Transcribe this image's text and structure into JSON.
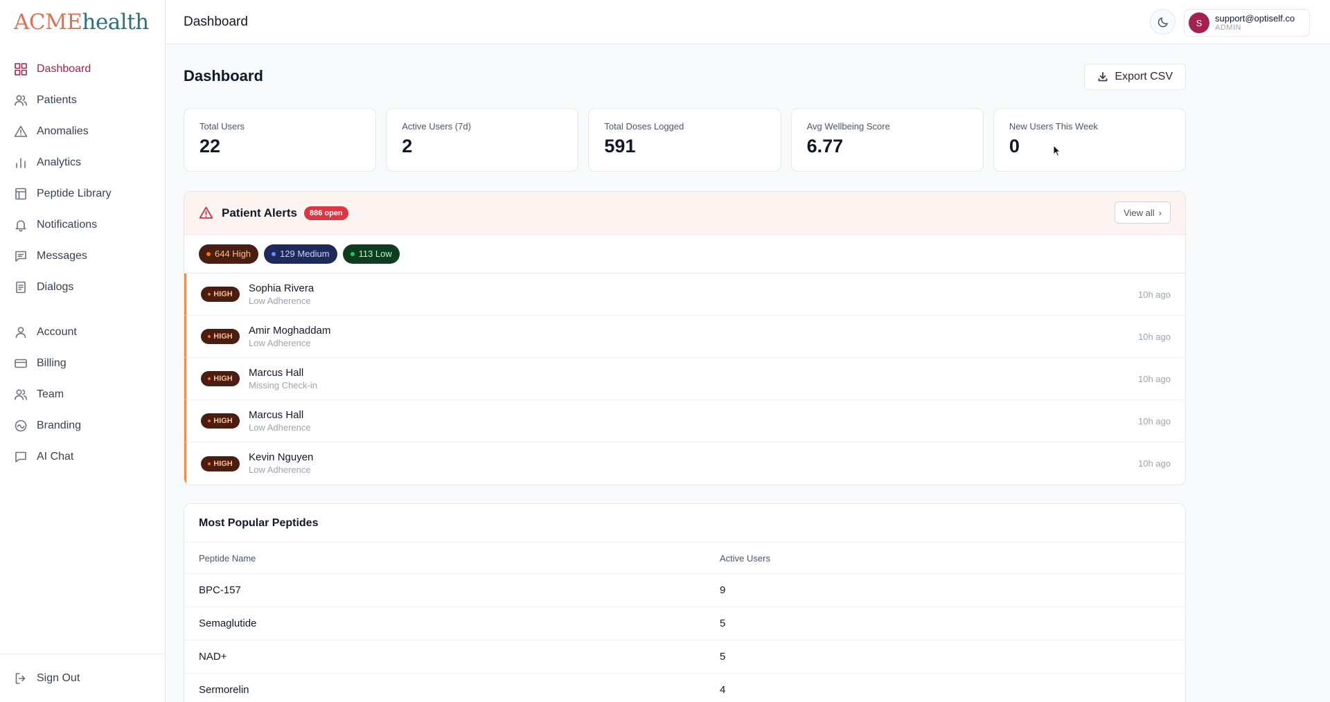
{
  "logo": {
    "part1": "ACME",
    "part2": "health"
  },
  "sidebar": {
    "items": [
      {
        "label": "Dashboard",
        "icon": "grid-icon"
      },
      {
        "label": "Patients",
        "icon": "users-icon"
      },
      {
        "label": "Anomalies",
        "icon": "warning-icon"
      },
      {
        "label": "Analytics",
        "icon": "bar-chart-icon"
      },
      {
        "label": "Peptide Library",
        "icon": "library-icon"
      },
      {
        "label": "Notifications",
        "icon": "bell-icon"
      },
      {
        "label": "Messages",
        "icon": "message-icon"
      },
      {
        "label": "Dialogs",
        "icon": "document-icon"
      }
    ],
    "items2": [
      {
        "label": "Account",
        "icon": "user-icon"
      },
      {
        "label": "Billing",
        "icon": "credit-card-icon"
      },
      {
        "label": "Team",
        "icon": "team-icon"
      },
      {
        "label": "Branding",
        "icon": "branding-icon"
      },
      {
        "label": "AI Chat",
        "icon": "chat-icon"
      }
    ],
    "signout": "Sign Out"
  },
  "header": {
    "title": "Dashboard",
    "user": {
      "initial": "S",
      "email": "support@optiself.co",
      "role": "ADMIN"
    }
  },
  "main": {
    "title": "Dashboard",
    "export_label": "Export CSV",
    "stats": [
      {
        "label": "Total Users",
        "value": "22"
      },
      {
        "label": "Active Users (7d)",
        "value": "2"
      },
      {
        "label": "Total Doses Logged",
        "value": "591"
      },
      {
        "label": "Avg Wellbeing Score",
        "value": "6.77"
      },
      {
        "label": "New Users This Week",
        "value": "0"
      }
    ],
    "alerts": {
      "title": "Patient Alerts",
      "open_badge": "886 open",
      "view_all": "View all",
      "pills": {
        "high": "644 High",
        "medium": "129 Medium",
        "low": "113 Low"
      },
      "severity_label": "HIGH",
      "rows": [
        {
          "name": "Sophia Rivera",
          "type": "Low Adherence",
          "time": "10h ago"
        },
        {
          "name": "Amir Moghaddam",
          "type": "Low Adherence",
          "time": "10h ago"
        },
        {
          "name": "Marcus Hall",
          "type": "Missing Check-in",
          "time": "10h ago"
        },
        {
          "name": "Marcus Hall",
          "type": "Low Adherence",
          "time": "10h ago"
        },
        {
          "name": "Kevin Nguyen",
          "type": "Low Adherence",
          "time": "10h ago"
        }
      ]
    },
    "peptides": {
      "title": "Most Popular Peptides",
      "columns": [
        "Peptide Name",
        "Active Users"
      ],
      "rows": [
        [
          "BPC-157",
          "9"
        ],
        [
          "Semaglutide",
          "5"
        ],
        [
          "NAD+",
          "5"
        ],
        [
          "Sermorelin",
          "4"
        ]
      ]
    }
  },
  "colors": {
    "accent": "#a3204f",
    "alert_high": "#f97316",
    "alert_medium": "#6b8cff",
    "alert_low": "#22c55e",
    "badge_red": "#dc3545"
  }
}
